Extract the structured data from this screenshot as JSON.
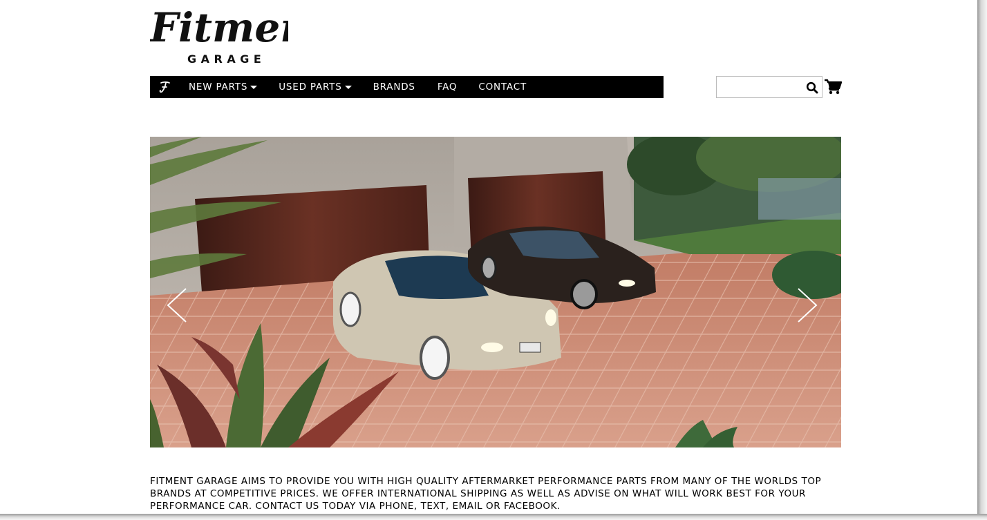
{
  "logo": {
    "script": "Fitment",
    "sub": "GARAGE"
  },
  "nav": {
    "items": [
      {
        "label": "NEW PARTS",
        "dropdown": true
      },
      {
        "label": "USED PARTS",
        "dropdown": true
      },
      {
        "label": "BRANDS",
        "dropdown": false
      },
      {
        "label": "FAQ",
        "dropdown": false
      },
      {
        "label": "CONTACT",
        "dropdown": false
      }
    ]
  },
  "search": {
    "value": "",
    "placeholder": ""
  },
  "icons": {
    "brand": "fitment-f-icon",
    "search": "search-icon",
    "cart": "cart-icon",
    "prev": "chevron-left-icon",
    "next": "chevron-right-icon"
  },
  "intro": {
    "text": "FITMENT GARAGE AIMS TO PROVIDE YOU WITH HIGH QUALITY AFTERMARKET PERFORMANCE PARTS FROM MANY OF THE WORLDS TOP BRANDS AT COMPETITIVE PRICES. WE OFFER INTERNATIONAL SHIPPING AS WELL AS ADVISE ON WHAT WILL WORK BEST FOR YOUR PERFORMANCE CAR. CONTACT US TODAY VIA PHONE, TEXT, EMAIL OR FACEBOOK."
  },
  "colors": {
    "nav_bg": "#000000",
    "nav_text": "#ffffff",
    "page_bg": "#ffffff"
  }
}
